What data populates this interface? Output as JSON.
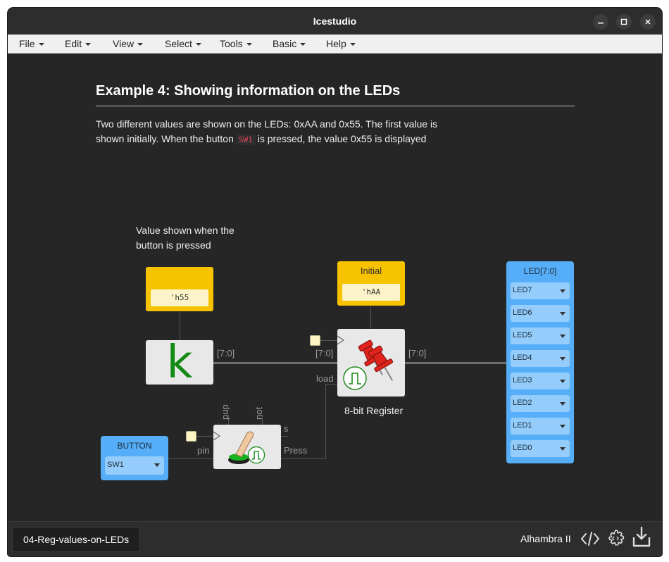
{
  "window": {
    "title": "Icestudio"
  },
  "menu": [
    {
      "label": "File"
    },
    {
      "label": "Edit"
    },
    {
      "label": "View"
    },
    {
      "label": "Select"
    },
    {
      "label": "Tools"
    },
    {
      "label": "Basic"
    },
    {
      "label": "Help"
    }
  ],
  "doc": {
    "heading": "Example 4: Showing information on the LEDs",
    "para_part1": "Two different values are shown on the LEDs: 0xAA and 0x55. The first value is shown initially. When the button",
    "para_code": "SW1",
    "para_part2": "is pressed, the value 0x55 is displayed"
  },
  "note": {
    "text": "Value shown when the button is pressed"
  },
  "const_55": {
    "value": "'h55"
  },
  "const_initial": {
    "title": "Initial",
    "value": "'hAA"
  },
  "k_block": {
    "glyph": "k"
  },
  "wire_labels": {
    "k_out": "[7:0]",
    "reg_in": "[7:0]",
    "reg_out": "[7:0]",
    "load": "load"
  },
  "register": {
    "label": "8-bit Register"
  },
  "button_block": {
    "pup": "pup",
    "not": "not",
    "s": "s",
    "pin": "pin",
    "press": "Press"
  },
  "button_input": {
    "title": "BUTTON",
    "value": "SW1"
  },
  "led_output": {
    "title": "LED[7:0]",
    "pins": [
      "LED7",
      "LED6",
      "LED5",
      "LED4",
      "LED3",
      "LED2",
      "LED1",
      "LED0"
    ]
  },
  "statusbar": {
    "file": "04-Reg-values-on-LEDs",
    "board": "Alhambra II"
  },
  "icons": [
    "close-icon",
    "maximize-icon",
    "minimize-icon",
    "code-icon",
    "gear-icon",
    "download-icon",
    "pushpin-icon",
    "push-button-icon",
    "clock-pulse-icon"
  ],
  "colors": {
    "constant": "#f7c300",
    "io": "#55aef7",
    "canvas": "#262626",
    "code": "#e8455b",
    "k": "#138a13",
    "pin": "#e0241d"
  }
}
